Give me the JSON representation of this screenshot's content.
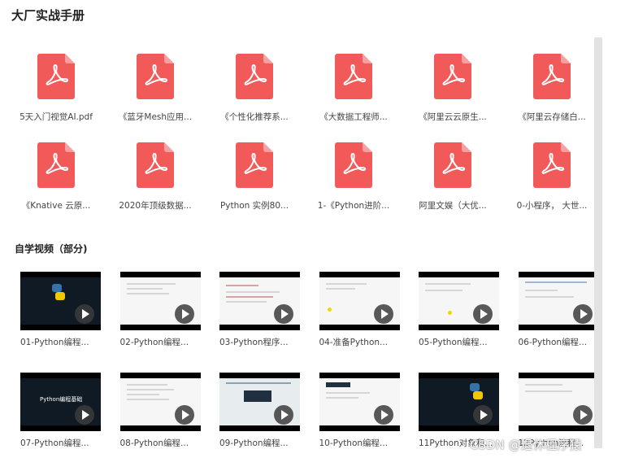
{
  "page_title": "大厂实战手册",
  "files": [
    {
      "name": "5天入门视觉AI.pdf",
      "icon": "pdf-icon"
    },
    {
      "name": "《蓝牙Mesh应用...",
      "icon": "pdf-icon"
    },
    {
      "name": "《个性化推荐系...",
      "icon": "pdf-icon"
    },
    {
      "name": "《大数据工程师...",
      "icon": "pdf-icon"
    },
    {
      "name": "《阿里云云原生...",
      "icon": "pdf-icon"
    },
    {
      "name": "《阿里云存储白...",
      "icon": "pdf-icon"
    },
    {
      "name": "《Knative 云原...",
      "icon": "pdf-icon"
    },
    {
      "name": "2020年顶级数据...",
      "icon": "pdf-icon"
    },
    {
      "name": "Python 实例80...",
      "icon": "pdf-icon"
    },
    {
      "name": "1-《Python进阶...",
      "icon": "pdf-icon"
    },
    {
      "name": "阿里文娱（大优...",
      "icon": "pdf-icon"
    },
    {
      "name": "0-小程序， 大世...",
      "icon": "pdf-icon"
    }
  ],
  "videos_section_title": "自学视频（部分)",
  "videos": [
    {
      "name": "01-Python编程...",
      "thumb_caption": ""
    },
    {
      "name": "02-Python编程...",
      "thumb_caption": ""
    },
    {
      "name": "03-Python程序...",
      "thumb_caption": ""
    },
    {
      "name": "04-准备Python...",
      "thumb_caption": ""
    },
    {
      "name": "05-Python编程...",
      "thumb_caption": ""
    },
    {
      "name": "06-Python编程...",
      "thumb_caption": ""
    },
    {
      "name": "07-Python编程...",
      "thumb_caption": "Python编程基础"
    },
    {
      "name": "08-Python编程...",
      "thumb_caption": ""
    },
    {
      "name": "09-Python编程...",
      "thumb_caption": ""
    },
    {
      "name": "10-Python编程...",
      "thumb_caption": ""
    },
    {
      "name": "11Python对象和...",
      "thumb_caption": ""
    },
    {
      "name": "12Python流程...",
      "thumb_caption": ""
    }
  ],
  "watermark": "CSDN @退休程序猿",
  "colors": {
    "pdf_red": "#f25a5a",
    "pdf_fold": "#f8a0a0"
  }
}
